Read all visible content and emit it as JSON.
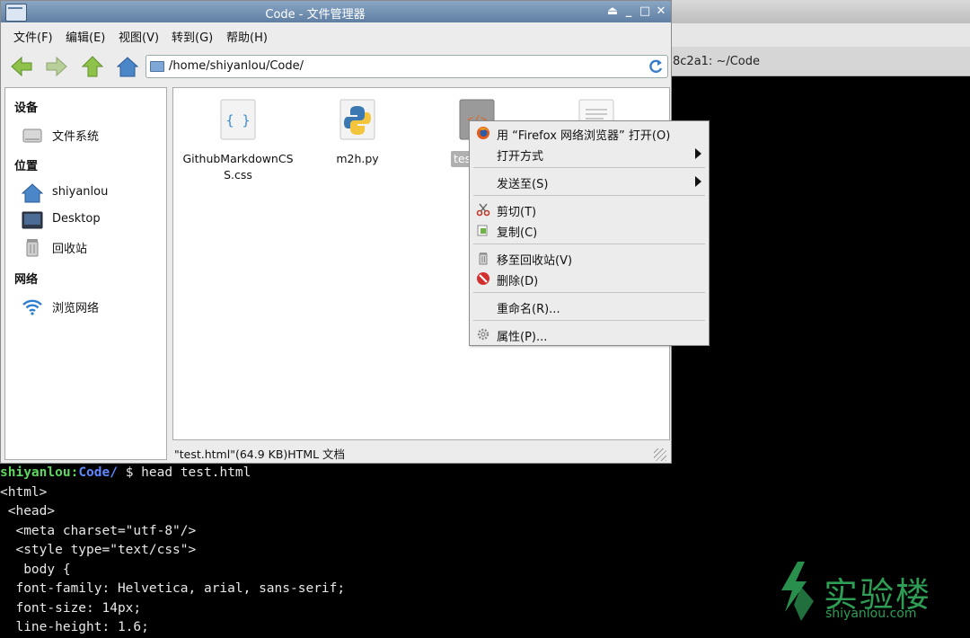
{
  "terminal": {
    "tab_title": "8c2a1: ~/Code",
    "prompt": {
      "user": "shiyanlou:",
      "path": "Code/",
      "dollar": " $ ",
      "command": "head test.html"
    },
    "lines": [
      "<html>",
      " <head>",
      "  <meta charset=\"utf-8\"/>",
      "  <style type=\"text/css\">",
      "   body {",
      "  font-family: Helvetica, arial, sans-serif;",
      "  font-size: 14px;",
      "  line-height: 1.6;"
    ]
  },
  "file_manager": {
    "title": "Code - 文件管理器",
    "controls": {
      "eject": "⏏",
      "minimize": "_",
      "maximize": "□",
      "close": "✕"
    },
    "menus": [
      "文件(F)",
      "编辑(E)",
      "视图(V)",
      "转到(G)",
      "帮助(H)"
    ],
    "toolbar": {
      "back": "back-arrow-icon",
      "forward": "forward-arrow-icon",
      "up": "up-arrow-icon",
      "home": "home-icon",
      "location": "/home/shiyanlou/Code/"
    },
    "sidebar": {
      "devices_header": "设备",
      "devices": [
        {
          "label": "文件系统",
          "icon": "drive-icon"
        }
      ],
      "places_header": "位置",
      "places": [
        {
          "label": "shiyanlou",
          "icon": "home-folder-icon"
        },
        {
          "label": "Desktop",
          "icon": "desktop-icon"
        },
        {
          "label": "回收站",
          "icon": "trash-icon"
        }
      ],
      "network_header": "网络",
      "network": [
        {
          "label": "浏览网络",
          "icon": "wifi-icon"
        }
      ]
    },
    "files": [
      {
        "name_line1": "GithubMarkdownCS",
        "name_line2": "S.css",
        "icon": "css-file-icon"
      },
      {
        "name_line1": "m2h.py",
        "name_line2": "",
        "icon": "python-file-icon"
      },
      {
        "name_line1": "tes",
        "name_line2": "",
        "icon": "html-file-icon"
      },
      {
        "name_line1": "",
        "name_line2": "",
        "icon": "text-file-icon"
      }
    ],
    "status": "\"test.html\"(64.9 KB)HTML 文档"
  },
  "context_menu": {
    "open_with_firefox": "用 “Firefox 网络浏览器” 打开(O)",
    "open_with": "打开方式",
    "send_to": "发送至(S)",
    "cut": "剪切(T)",
    "copy": "复制(C)",
    "move_to_trash": "移至回收站(V)",
    "delete": "删除(D)",
    "rename": "重命名(R)...",
    "properties": "属性(P)..."
  },
  "watermark": {
    "title": "实验楼",
    "subtitle": "shiyanlou.com"
  },
  "colors": {
    "prompt_user": "#5fd75f",
    "prompt_path": "#5f87ff",
    "titlebar": "#6b8ab0",
    "brand_green": "#2e9e55"
  }
}
